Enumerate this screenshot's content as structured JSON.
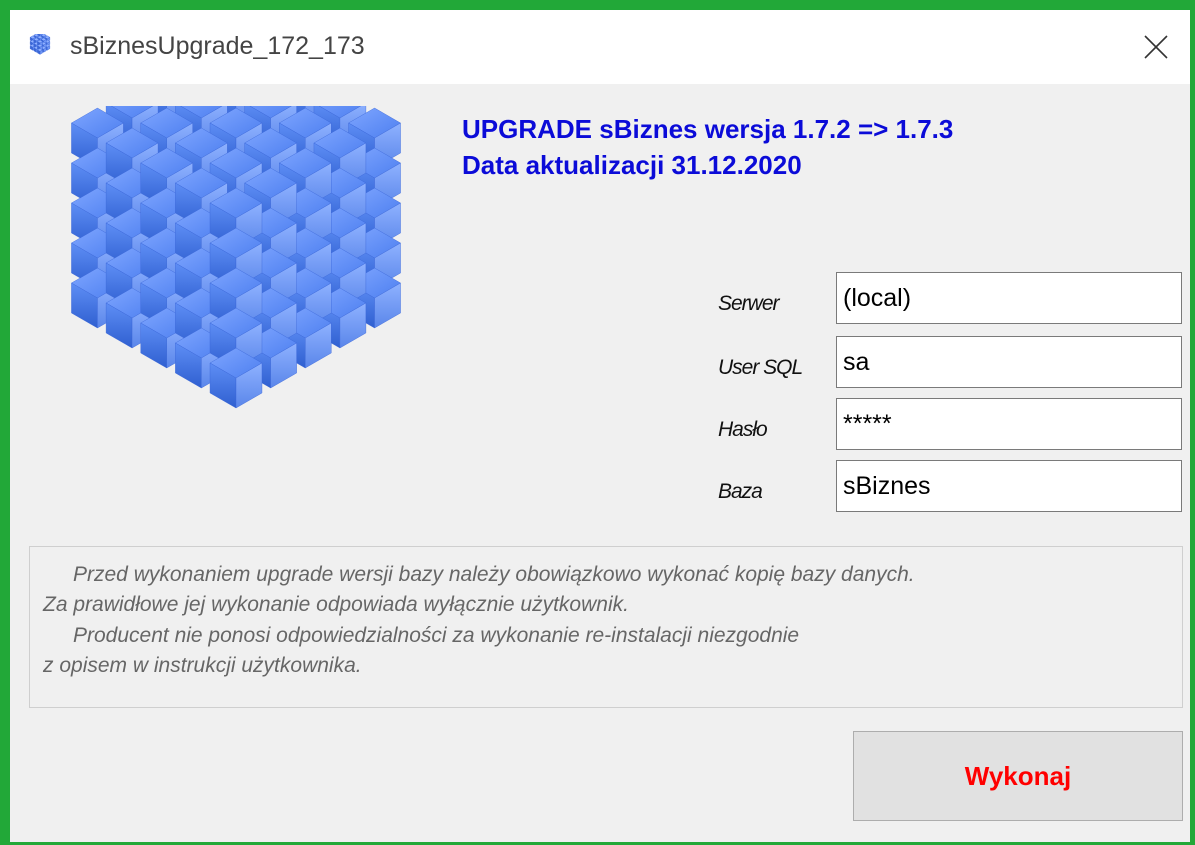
{
  "window": {
    "title": "sBiznesUpgrade_172_173",
    "accent": "#22a838"
  },
  "header": {
    "line1": "UPGRADE sBiznes wersja 1.7.2 => 1.7.3",
    "line2": "Data aktualizacji 31.12.2020",
    "color": "#0b0bd8"
  },
  "form": {
    "server_label": "Serwer",
    "server_value": "(local)",
    "user_label": "User SQL",
    "user_value": "sa",
    "password_label": "Hasło",
    "password_value": "*****",
    "database_label": "Baza",
    "database_value": "sBiznes"
  },
  "notice": {
    "line1": "Przed wykonaniem upgrade wersji bazy należy obowiązkowo wykonać kopię bazy danych.",
    "line2": "Za prawidłowe jej wykonanie odpowiada wyłącznie użytkownik.",
    "line3": "Producent nie ponosi odpowiedzialności za wykonanie re-instalacji niezgodnie",
    "line4": "z opisem w instrukcji użytkownika."
  },
  "actions": {
    "execute_label": "Wykonaj",
    "execute_color": "#ff0000"
  },
  "icons": {
    "app": "cube-grid-icon",
    "close": "close-icon",
    "logo": "database-cube-icon"
  }
}
